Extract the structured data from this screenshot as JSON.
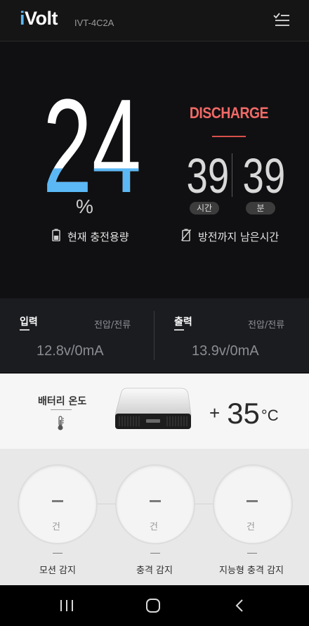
{
  "header": {
    "logo_i": "i",
    "logo_rest": "Volt",
    "model": "IVT-4C2A",
    "menu_icon": "checklist-menu-icon"
  },
  "battery": {
    "level": "24",
    "level_value": 24,
    "percent_sign": "%",
    "fill_color": "#5bb8f5",
    "capacity_label": "현재 충전용량",
    "capacity_icon": "battery-icon"
  },
  "discharge": {
    "status": "DISCHARGE",
    "status_color": "#f06a66",
    "hours": "39",
    "hours_unit": "시간",
    "minutes": "39",
    "minutes_unit": "분",
    "remaining_label": "방전까지 남은시간",
    "remaining_icon": "battery-off-icon"
  },
  "io": {
    "input": {
      "title": "입력",
      "sub": "전압/전류",
      "value": "12.8v/0mA"
    },
    "output": {
      "title": "출력",
      "sub": "전압/전류",
      "value": "13.9v/0mA"
    }
  },
  "temperature": {
    "label": "배터리 온도",
    "icon": "thermometer-icon",
    "sign": "+",
    "value": "35",
    "unit": "°C"
  },
  "sensors": [
    {
      "value": "–",
      "unit": "건",
      "label": "모션 감지"
    },
    {
      "value": "–",
      "unit": "건",
      "label": "충격 감지"
    },
    {
      "value": "–",
      "unit": "건",
      "label": "지능형 충격 감지"
    }
  ],
  "navbar": {
    "recents_icon": "recent-apps-icon",
    "home_icon": "home-icon",
    "back_icon": "back-icon"
  }
}
